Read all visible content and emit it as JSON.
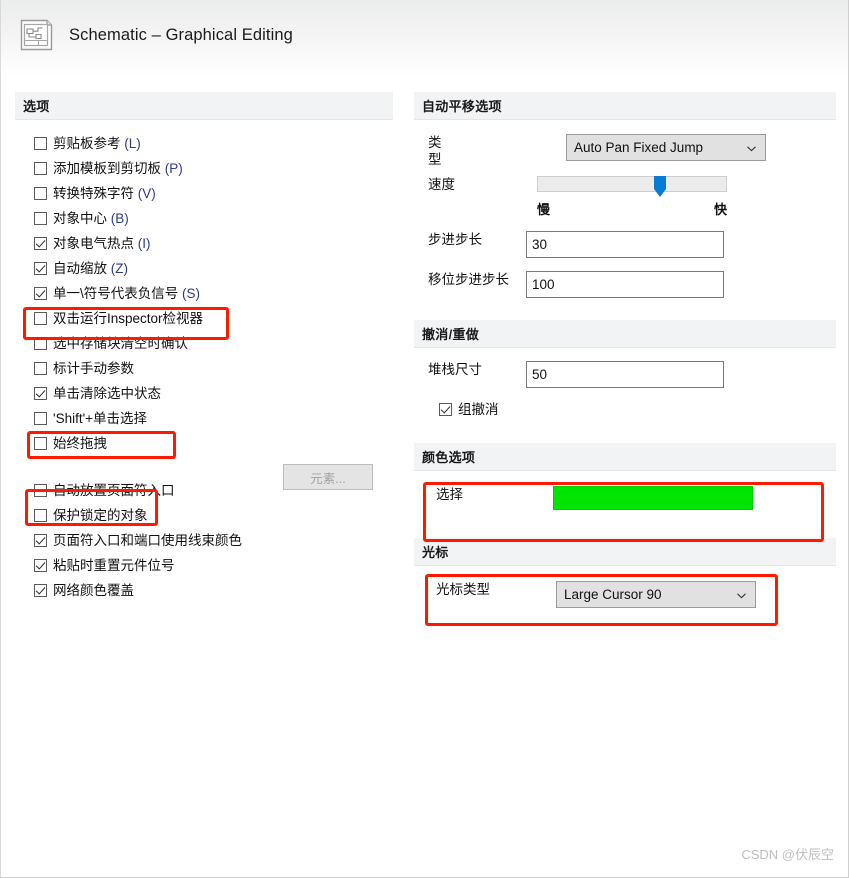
{
  "window": {
    "title": "Schematic – Graphical Editing",
    "icon": "schematic-document-icon"
  },
  "left_panel": {
    "header": "选项",
    "options_group_1": [
      {
        "label": "剪贴板参考",
        "mnemonic": "(L)",
        "checked": false
      },
      {
        "label": "添加模板到剪切板",
        "mnemonic": "(P)",
        "checked": false
      },
      {
        "label": "转换特殊字符",
        "mnemonic": "(V)",
        "checked": false
      },
      {
        "label": "对象中心",
        "mnemonic": "(B)",
        "checked": false
      },
      {
        "label": "对象电气热点",
        "mnemonic": "(I)",
        "checked": true
      },
      {
        "label": "自动缩放",
        "mnemonic": "(Z)",
        "checked": true
      },
      {
        "label": "单一\\符号代表负信号",
        "mnemonic": "(S)",
        "checked": true
      },
      {
        "label": "双击运行Inspector检视器",
        "mnemonic": "",
        "checked": false
      },
      {
        "label": "选中存储块清空时确认",
        "mnemonic": "",
        "checked": false
      },
      {
        "label": "标计手动参数",
        "mnemonic": "",
        "checked": false
      },
      {
        "label": "单击清除选中状态",
        "mnemonic": "",
        "checked": true
      },
      {
        "label": "'Shift'+单击选择",
        "mnemonic": "",
        "checked": false
      },
      {
        "label": "始终拖拽",
        "mnemonic": "",
        "checked": false
      }
    ],
    "options_group_2": [
      {
        "label": "自动放置页面符入口",
        "mnemonic": "",
        "checked": false
      },
      {
        "label": "保护锁定的对象",
        "mnemonic": "",
        "checked": false
      },
      {
        "label": "页面符入口和端口使用线束颜色",
        "mnemonic": "",
        "checked": true
      },
      {
        "label": "粘贴时重置元件位号",
        "mnemonic": "",
        "checked": true
      },
      {
        "label": "网络颜色覆盖",
        "mnemonic": "",
        "checked": true
      }
    ],
    "elements_button": "元素..."
  },
  "right_panel": {
    "autopan": {
      "header": "自动平移选项",
      "type_label": "类型",
      "type_value": "Auto Pan Fixed Jump",
      "speed_label": "速度",
      "speed_slow": "慢",
      "speed_fast": "快",
      "speed_percent": 65,
      "step_label": "步进步长",
      "step_value": "30",
      "shift_step_label": "移位步进步长",
      "shift_step_value": "100"
    },
    "undo_redo": {
      "header": "撤消/重做",
      "stack_label": "堆栈尺寸",
      "stack_value": "50",
      "group_undo_label": "组撤消",
      "group_undo_checked": true
    },
    "color_options": {
      "header": "颜色选项",
      "selection_label": "选择",
      "selection_color": "#00e500"
    },
    "cursor": {
      "header": "光标",
      "cursor_type_label": "光标类型",
      "cursor_type_value": "Large Cursor 90"
    }
  },
  "annotations": {
    "accent_color": "#fe1a00",
    "boxes": [
      {
        "name": "highlight-single-backslash-negative-signal"
      },
      {
        "name": "highlight-click-clears-selection"
      },
      {
        "name": "highlight-always-drag"
      },
      {
        "name": "highlight-selection-color"
      },
      {
        "name": "highlight-cursor-type"
      }
    ]
  },
  "watermark": "CSDN @伏辰空"
}
